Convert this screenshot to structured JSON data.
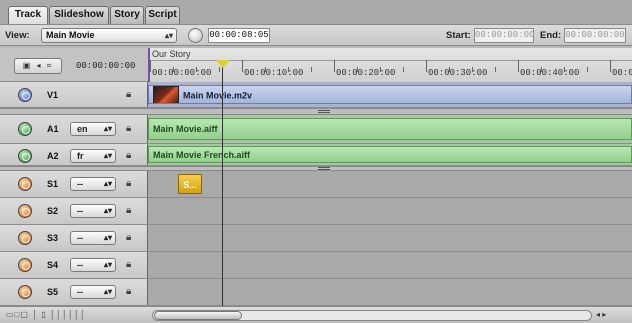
{
  "tabs": [
    {
      "label": "Track",
      "active": true
    },
    {
      "label": "Slideshow",
      "active": false
    },
    {
      "label": "Story",
      "active": false
    },
    {
      "label": "Script",
      "active": false
    }
  ],
  "view": {
    "label": "View:",
    "selected": "Main Movie",
    "timecode": "00:00:08:05",
    "start_label": "Start:",
    "start_value": "00:00:00:00",
    "end_label": "End:",
    "end_value": "00:00:00:00"
  },
  "header": {
    "current_time": "00:00:00:00",
    "story_name": "Our Story",
    "ruler_ticks": [
      "00:00:00:00",
      "00:00:10:00",
      "00:00:20:00",
      "00:00:30:00",
      "00:00:40:00",
      "00:0"
    ]
  },
  "tracks": {
    "v1": {
      "name": "V1",
      "clip": "Main Movie.m2v"
    },
    "a1": {
      "name": "A1",
      "stream": "en",
      "clip": "Main Movie.aiff"
    },
    "a2": {
      "name": "A2",
      "stream": "fr",
      "clip": "Main Movie French.aiff"
    },
    "s1": {
      "name": "S1",
      "stream": "--",
      "clip": "S..."
    },
    "s2": {
      "name": "S2",
      "stream": "--"
    },
    "s3": {
      "name": "S3",
      "stream": "--"
    },
    "s4": {
      "name": "S4",
      "stream": "--"
    },
    "s5": {
      "name": "S5",
      "stream": "--"
    }
  },
  "icons": {
    "lock": "lock-icon",
    "popup_arrow": "updown-arrow-icon",
    "timecode": "clock-icon"
  },
  "colors": {
    "video_clip": "#a5b4da",
    "audio_clip": "#93cf8e",
    "subtitle_clip": "#d6a20f",
    "playhead": "#d9d22a",
    "story_marker": "#7a4fa0"
  }
}
